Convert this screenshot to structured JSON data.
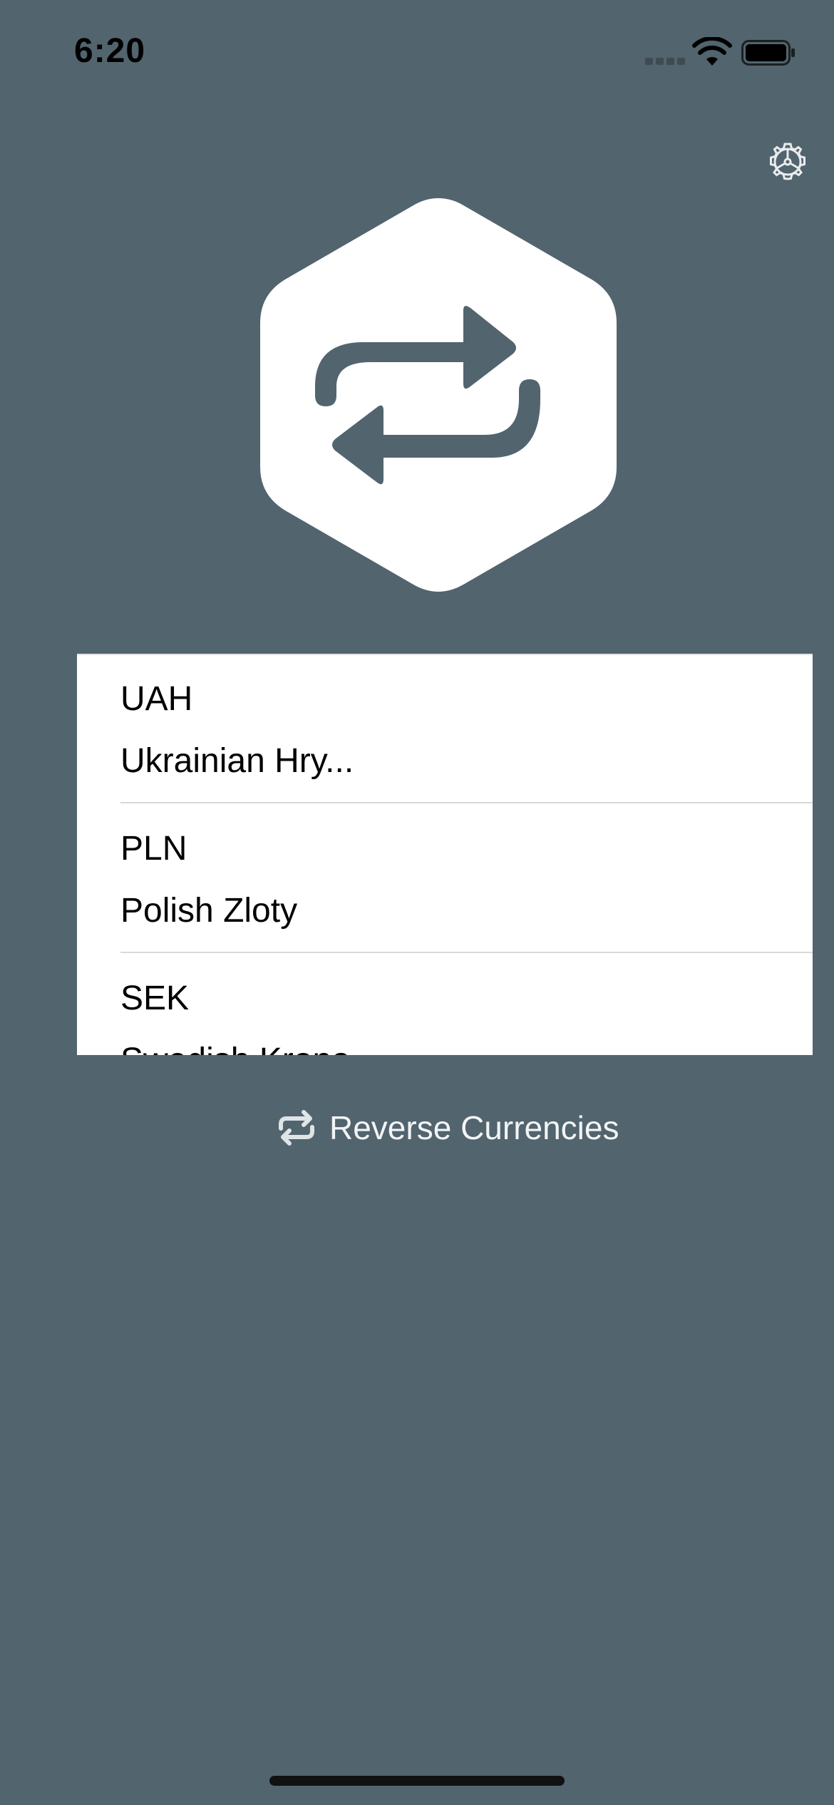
{
  "status_bar": {
    "time": "6:20",
    "icons": [
      "signal-icon",
      "wifi-icon",
      "battery-icon"
    ]
  },
  "header": {
    "settings_icon": "gear-icon"
  },
  "logo": {
    "icon": "exchange-arrows-icon",
    "colors": {
      "hexagon": "#ffffff",
      "arrows": "#52646e"
    }
  },
  "currency_picker": {
    "items": [
      {
        "code": "UAH",
        "name": "Ukrainian Hry..."
      },
      {
        "code": "PLN",
        "name": "Polish Zloty"
      },
      {
        "code": "SEK",
        "name": "Swedish Krona"
      }
    ]
  },
  "reverse_button": {
    "icon": "repeat-icon",
    "label": "Reverse Currencies"
  },
  "colors": {
    "background": "#52646e",
    "list_background": "#ffffff",
    "divider": "#d9d9d9"
  }
}
